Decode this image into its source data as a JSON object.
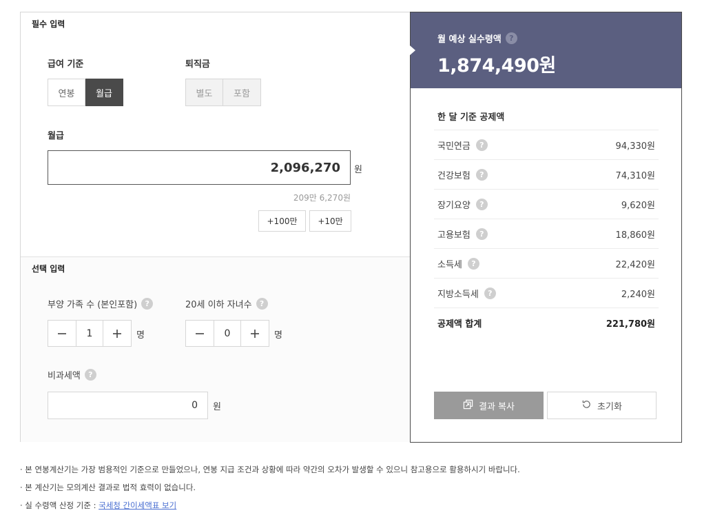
{
  "required": {
    "title": "필수 입력",
    "pay_basis": {
      "label": "급여 기준",
      "options": [
        "연봉",
        "월급"
      ],
      "selected": "월급"
    },
    "severance": {
      "label": "퇴직금",
      "options": [
        "별도",
        "포함"
      ]
    },
    "salary": {
      "label": "월급",
      "value": "2,096,270",
      "unit": "원",
      "hint": "209만 6,270원"
    },
    "add_buttons": [
      "+100만",
      "+10만"
    ]
  },
  "optional": {
    "title": "선택 입력",
    "dependents": {
      "label": "부양 가족 수 (본인포함)",
      "value": "1",
      "unit": "명"
    },
    "children": {
      "label": "20세 이하 자녀수",
      "value": "0",
      "unit": "명"
    },
    "nontax": {
      "label": "비과세액",
      "value": "0",
      "unit": "원"
    }
  },
  "result": {
    "label": "월 예상 실수령액",
    "amount": "1,874,490원",
    "deduction_title": "한 달 기준 공제액",
    "deductions": [
      {
        "name": "국민연금",
        "value": "94,330원"
      },
      {
        "name": "건강보험",
        "value": "74,310원"
      },
      {
        "name": "장기요양",
        "value": "9,620원"
      },
      {
        "name": "고용보험",
        "value": "18,860원"
      },
      {
        "name": "소득세",
        "value": "22,420원"
      },
      {
        "name": "지방소득세",
        "value": "2,240원"
      }
    ],
    "total": {
      "name": "공제액 합계",
      "value": "221,780원"
    },
    "copy_label": "결과 복사",
    "reset_label": "초기화"
  },
  "help_glyph": "?",
  "notes": [
    "· 본 연봉계산기는 가장 범용적인 기준으로 만들었으나, 연봉 지급 조건과 상황에 따라 약간의 오차가 발생할 수 있으니 참고용으로 활용하시기 바랍니다.",
    "· 본 계산기는 모의계산 결과로 법적 효력이 없습니다."
  ],
  "note_link": {
    "prefix": "· 실 수령액 산정 기준 : ",
    "text": "국세청 간이세액표 보기"
  },
  "colors": {
    "accent": "#5b5f80",
    "selected": "#4a4a4a",
    "link": "#4a6fd1",
    "copy_button": "#9a9a9a"
  }
}
